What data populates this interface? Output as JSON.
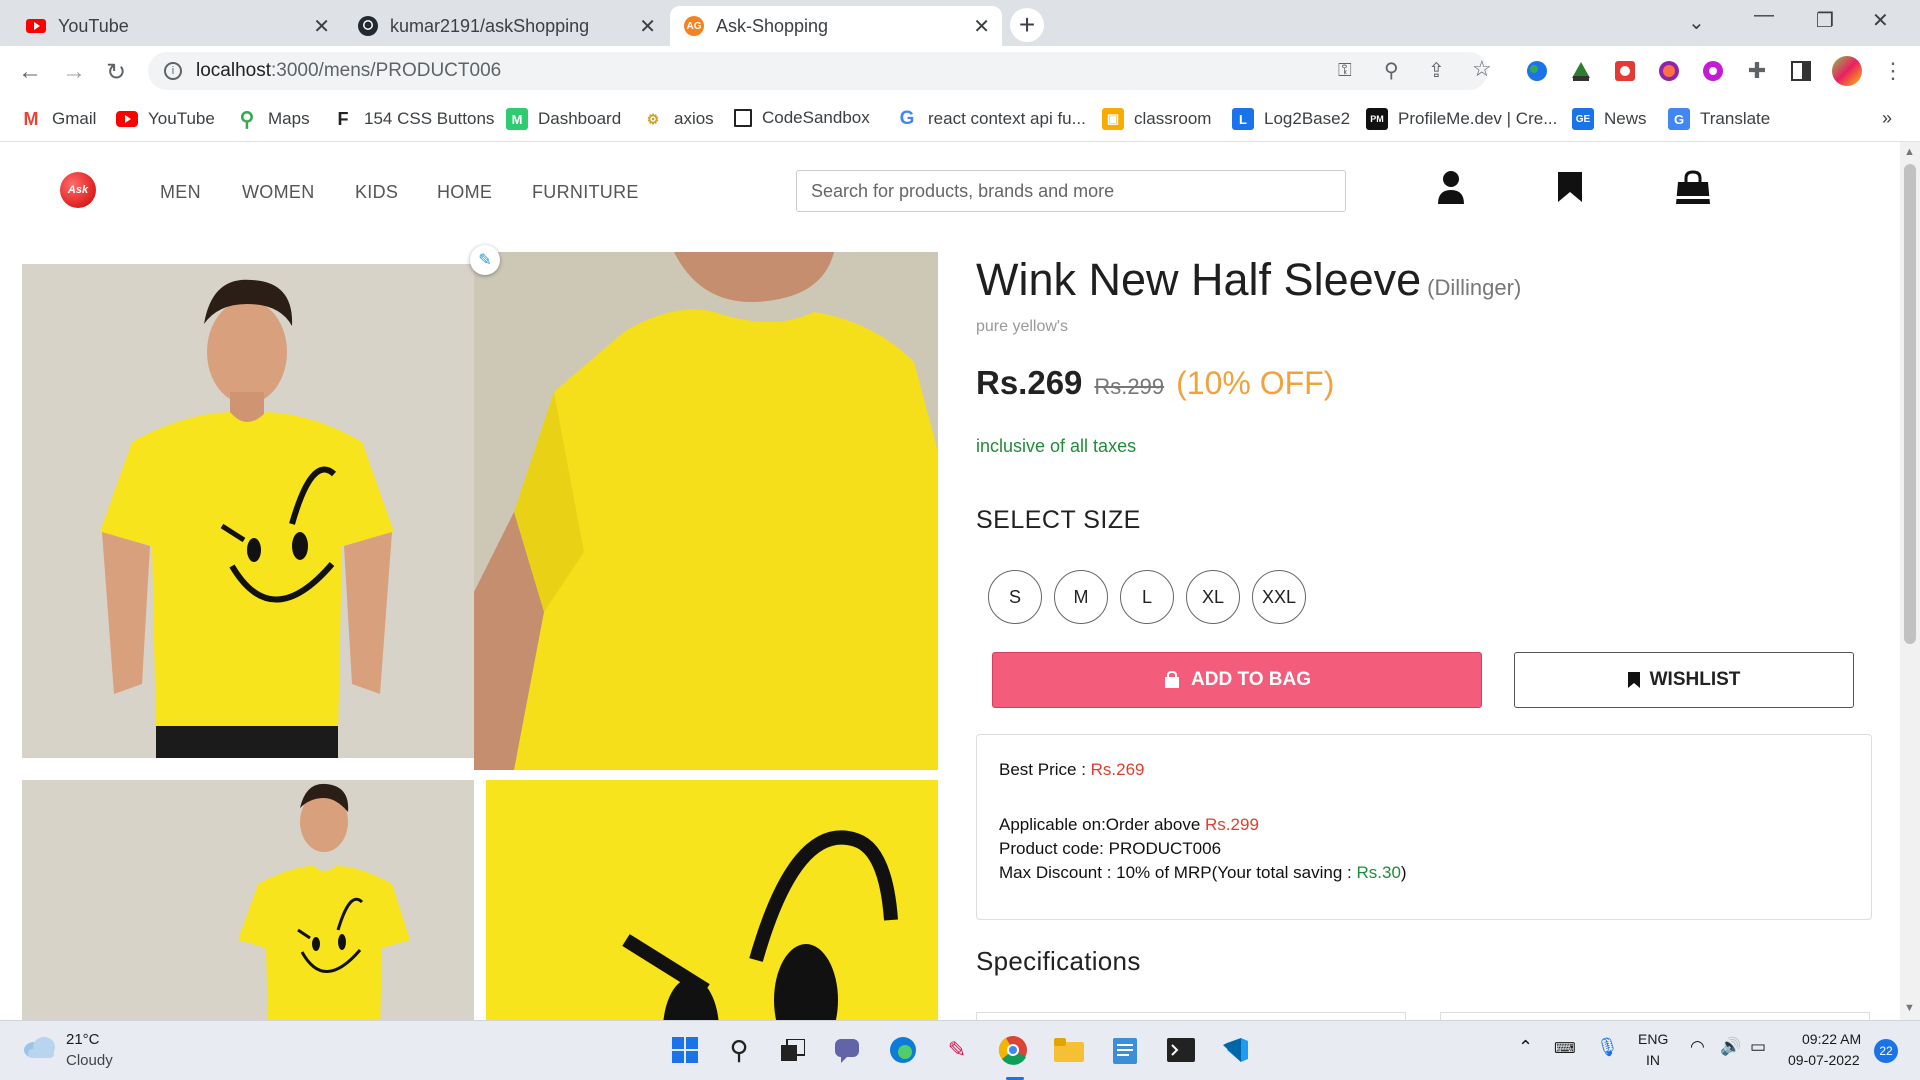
{
  "browser": {
    "tabs": [
      {
        "label": "YouTube",
        "icon": "youtube-icon"
      },
      {
        "label": "kumar2191/askShopping",
        "icon": "github-icon"
      },
      {
        "label": "Ask-Shopping",
        "icon": "ag-icon",
        "active": true
      }
    ],
    "ag_favicon_text": "AG",
    "url_host": "localhost",
    "url_rest": ":3000/mens/PRODUCT006",
    "bookmarks": [
      {
        "label": "Gmail",
        "icon": "gmail-icon"
      },
      {
        "label": "YouTube",
        "icon": "youtube-icon"
      },
      {
        "label": "Maps",
        "icon": "maps-icon"
      },
      {
        "label": "154 CSS Buttons",
        "icon": "css-buttons-icon"
      },
      {
        "label": "Dashboard",
        "icon": "dashboard-icon"
      },
      {
        "label": "axios",
        "icon": "axios-icon"
      },
      {
        "label": "CodeSandbox",
        "icon": "codesandbox-icon"
      },
      {
        "label": "react context api fu...",
        "icon": "google-icon"
      },
      {
        "label": "classroom",
        "icon": "classroom-icon"
      },
      {
        "label": "Log2Base2",
        "icon": "log2base2-icon"
      },
      {
        "label": "ProfileMe.dev | Cre...",
        "icon": "profileme-icon"
      },
      {
        "label": "News",
        "icon": "news-icon"
      },
      {
        "label": "Translate",
        "icon": "translate-icon"
      }
    ],
    "more_bookmarks": "»"
  },
  "site": {
    "logo_text": "Ask",
    "nav": [
      "MEN",
      "WOMEN",
      "KIDS",
      "HOME",
      "FURNITURE"
    ],
    "search_placeholder": "Search for products, brands and more"
  },
  "product": {
    "title": "Wink New Half Sleeve",
    "brand": "(Dillinger)",
    "subtitle": "pure yellow's",
    "price": "Rs.269",
    "mrp": "Rs.299",
    "discount": "(10% OFF)",
    "taxes_note": "inclusive of all taxes",
    "select_size_label": "SELECT SIZE",
    "sizes": [
      "S",
      "M",
      "L",
      "XL",
      "XXL"
    ],
    "add_to_bag_label": "ADD TO BAG",
    "wishlist_label": "WISHLIST",
    "offer": {
      "best_price_label": "Best Price : ",
      "best_price_value": "Rs.269",
      "applicable_label": "Applicable on:Order above ",
      "applicable_value": "Rs.299",
      "product_code_line": "Product code: PRODUCT006",
      "max_discount_label": "Max Discount : 10% of MRP(Your total saving : ",
      "max_discount_value": "Rs.30",
      "max_discount_suffix": ")"
    },
    "specifications_label": "Specifications"
  },
  "taskbar": {
    "weather_temp": "21°C",
    "weather_desc": "Cloudy",
    "lang_line1": "ENG",
    "lang_line2": "IN",
    "time": "09:22 AM",
    "date": "09-07-2022",
    "notification_count": "22"
  },
  "colors": {
    "accent_pink": "#f35c7b",
    "discount_orange": "#f0a23b",
    "tax_green": "#1f8c3a",
    "price_red": "#e03e2d",
    "shirt_yellow": "#f7e41c"
  }
}
